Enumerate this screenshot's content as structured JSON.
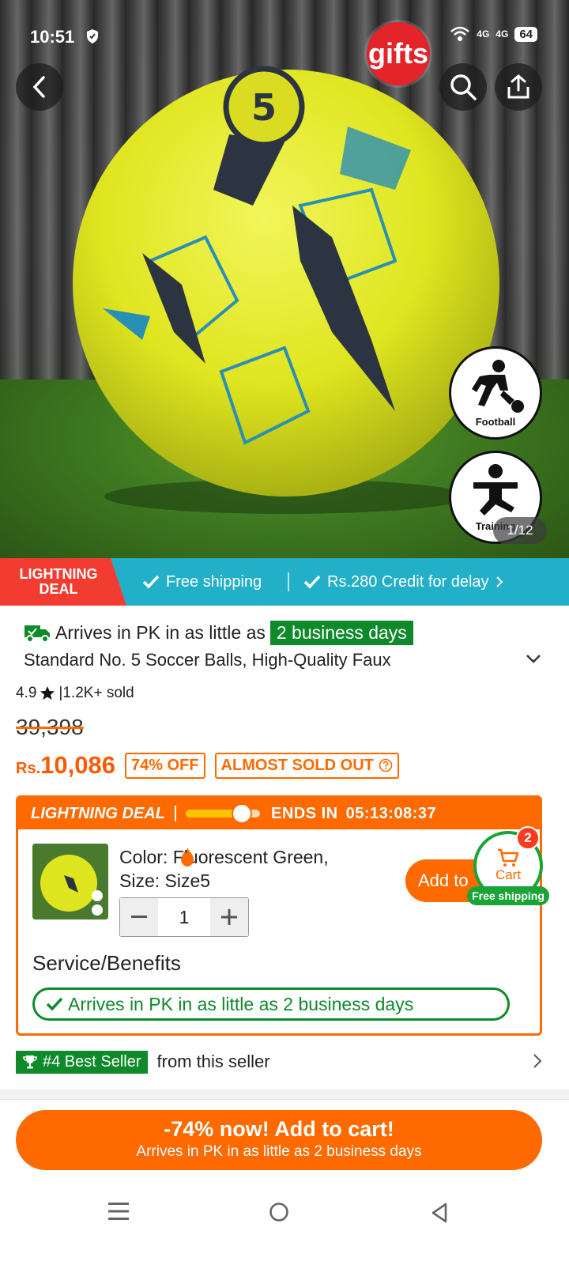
{
  "status_bar": {
    "time": "10:51",
    "signal1": "4G",
    "signal2": "4G",
    "battery": "64"
  },
  "hero": {
    "gifts_label": "gifts",
    "badges": [
      {
        "label": "Football"
      },
      {
        "label": "Training"
      }
    ],
    "image_counter": "1/12"
  },
  "deal_strip": {
    "tag_line1": "LIGHTNING",
    "tag_line2": "DEAL",
    "perk1": "Free shipping",
    "perk2": "Rs.280 Credit for delay"
  },
  "product": {
    "arrive_prefix": "Arrives in PK in as little as",
    "arrive_highlight": "2 business days",
    "title": "Standard No. 5 Soccer Balls, High-Quality Faux",
    "rating": "4.9",
    "sold": "|1.2K+ sold",
    "old_price": "39,398",
    "currency": "Rs.",
    "price": "10,086",
    "discount_tag": "74% OFF",
    "stock_tag": "ALMOST SOLD OUT"
  },
  "lightning_deal": {
    "title": "LIGHTNING DEAL",
    "progress": 0.75,
    "ends_label": "ENDS IN",
    "countdown": "05:13:08:37",
    "variant_line1": "Color:  Fluorescent Green,",
    "variant_line2": "Size: Size5",
    "quantity": "1",
    "add_to_label": "Add to",
    "cart_label": "Cart",
    "cart_count": "2",
    "cart_free_shipping": "Free shipping",
    "service_title": "Service/Benefits",
    "service_pill": "Arrives in PK in as little as 2 business days"
  },
  "seller": {
    "badge": "#4 Best Seller",
    "text": "from this seller"
  },
  "cta": {
    "line1": "-74% now! Add to cart!",
    "line2": "Arrives in PK in as little as 2 business days"
  },
  "colors": {
    "accent_orange": "#ff6a00",
    "green": "#0e8a2a",
    "teal_strip": "#22b0c9",
    "red_tag": "#f23c31"
  }
}
